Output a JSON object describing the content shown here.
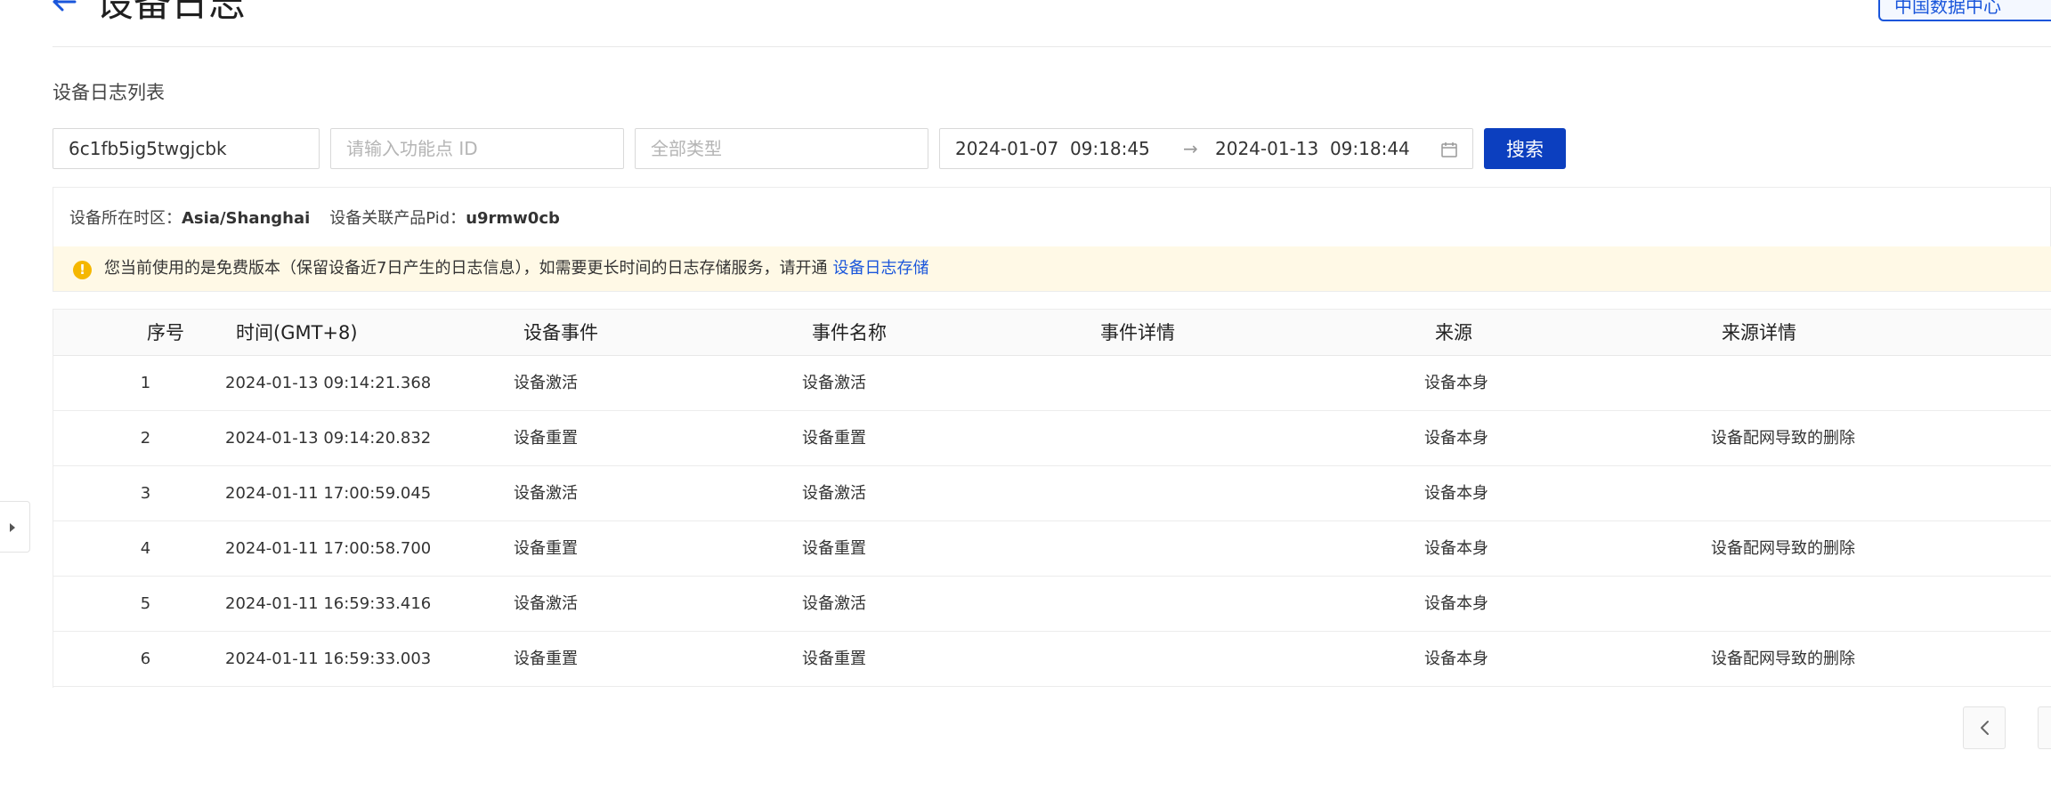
{
  "header": {
    "title": "设备日志",
    "datacenter_label": "中国数据中心"
  },
  "section_title": "设备日志列表",
  "filters": {
    "device_id_value": "6c1fb5ig5twgjcbk",
    "dp_id_placeholder": "请输入功能点 ID",
    "type_select_value": "全部类型",
    "date_start": "2024-01-07  09:18:45",
    "date_end": "2024-01-13  09:18:44",
    "date_separator": "→",
    "search_label": "搜索"
  },
  "info": {
    "timezone_label": "设备所在时区：",
    "timezone_value": "Asia/Shanghai",
    "pid_label": "设备关联产品Pid：",
    "pid_value": "u9rmw0cb",
    "notice_text": "您当前使用的是免费版本（保留设备近7日产生的日志信息），如需要更长时间的日志存储服务，请开通",
    "notice_link": "设备日志存储"
  },
  "table": {
    "columns": [
      "序号",
      "时间(GMT+8)",
      "设备事件",
      "事件名称",
      "事件详情",
      "来源",
      "来源详情"
    ],
    "rows": [
      {
        "index": "1",
        "time": "2024-01-13 09:14:21.368",
        "event": "设备激活",
        "name": "设备激活",
        "detail": "",
        "source": "设备本身",
        "source_detail": ""
      },
      {
        "index": "2",
        "time": "2024-01-13 09:14:20.832",
        "event": "设备重置",
        "name": "设备重置",
        "detail": "",
        "source": "设备本身",
        "source_detail": "设备配网导致的删除"
      },
      {
        "index": "3",
        "time": "2024-01-11 17:00:59.045",
        "event": "设备激活",
        "name": "设备激活",
        "detail": "",
        "source": "设备本身",
        "source_detail": ""
      },
      {
        "index": "4",
        "time": "2024-01-11 17:00:58.700",
        "event": "设备重置",
        "name": "设备重置",
        "detail": "",
        "source": "设备本身",
        "source_detail": "设备配网导致的删除"
      },
      {
        "index": "5",
        "time": "2024-01-11 16:59:33.416",
        "event": "设备激活",
        "name": "设备激活",
        "detail": "",
        "source": "设备本身",
        "source_detail": ""
      },
      {
        "index": "6",
        "time": "2024-01-11 16:59:33.003",
        "event": "设备重置",
        "name": "设备重置",
        "detail": "",
        "source": "设备本身",
        "source_detail": "设备配网导致的删除"
      }
    ]
  },
  "icons": {
    "back": "arrow-left-icon",
    "calendar": "calendar-icon",
    "warning": "warning-icon",
    "prev": "chevron-left-icon",
    "sidebar": "caret-right-icon"
  },
  "colors": {
    "primary": "#0c3fbf",
    "link": "#1a56db",
    "warning": "#f5b700",
    "notice_bg": "#fff9e6"
  }
}
